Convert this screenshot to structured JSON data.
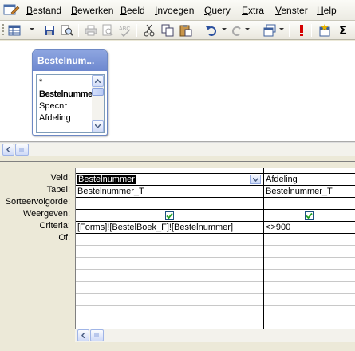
{
  "menu": {
    "items": [
      "Bestand",
      "Bewerken",
      "Beeld",
      "Invoegen",
      "Query",
      "Extra",
      "Venster",
      "Help"
    ]
  },
  "toolbar": {
    "icons": [
      "view-icon",
      "save-icon",
      "search-icon",
      "print-icon",
      "print-preview-icon",
      "spelling-icon",
      "cut-icon",
      "copy-icon",
      "paste-icon",
      "undo-icon",
      "query-type-icon",
      "run-icon",
      "show-table-icon",
      "totals-icon"
    ],
    "totals_label": "Σ"
  },
  "table_box": {
    "title": "Bestelnum...",
    "fields": [
      "*",
      "Bestelnummer",
      "Specnr",
      "Afdeling"
    ]
  },
  "grid": {
    "row_labels": [
      "Veld:",
      "Tabel:",
      "Sorteervolgorde:",
      "Weergeven:",
      "Criteria:",
      "Of:"
    ],
    "columns": [
      {
        "field": "Bestelnummer",
        "table": "Bestelnummer_T",
        "sort": "",
        "show": true,
        "criteria": "[Forms]![BestelBoek_F]![Bestelnummer]"
      },
      {
        "field": "Afdeling",
        "table": "Bestelnummer_T",
        "sort": "",
        "show": true,
        "criteria": "<>900"
      }
    ]
  },
  "colors": {
    "table_title_bg": "#7b93d6",
    "selection_bg": "#000000",
    "checkmark": "#21a121"
  }
}
